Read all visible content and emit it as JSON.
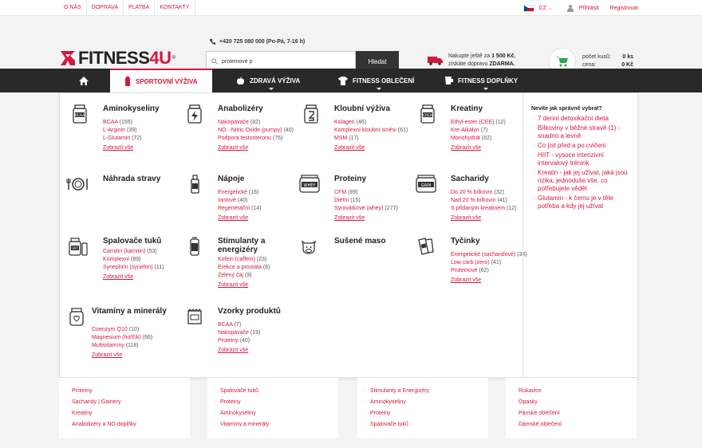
{
  "top": {
    "links": [
      "O NÁS",
      "DOPRAVA",
      "PLATBA",
      "KONTAKTY"
    ],
    "lang": "CZ",
    "login": "Přihlásit",
    "register": "Registrovat"
  },
  "header": {
    "logo_text_a": "FITNESS",
    "logo_text_b": "4U",
    "logo_reg": "®",
    "phone": "+420 725 080 000 (Po-Pá, 7-16 h)",
    "search_value": "proteinové p",
    "search_button": "Hledat",
    "ship_line1_pre": "Nakupte ještě za ",
    "ship_amount": "1 500 Kč",
    "ship_line1_post": ",",
    "ship_line2_pre": "získáte dopravu ",
    "ship_free": "ZDARMA.",
    "cart_count_label": "počet kusů:",
    "cart_count_value": "0 ks",
    "cart_price_label": "cena:",
    "cart_price_value": "0 Kč"
  },
  "nav": {
    "items": [
      "SPORTOVNÍ VÝŽIVA",
      "ZDRAVÁ VÝŽIVA",
      "FITNESS OBLEČENÍ",
      "FITNESS DOPLŇKY"
    ]
  },
  "mega": {
    "show_all": "Zobrazit vše",
    "categories": [
      {
        "title": "Aminokyseliny",
        "items": [
          {
            "n": "BCAA",
            "c": "(155)"
          },
          {
            "n": "L-Arginin",
            "c": "(39)"
          },
          {
            "n": "L-Glutamin",
            "c": "(72)"
          }
        ]
      },
      {
        "title": "Anabolizéry",
        "items": [
          {
            "n": "Nakopávače",
            "c": "(82)"
          },
          {
            "n": "NO - Nitric Oxide (pumpy)",
            "c": "(40)"
          },
          {
            "n": "Podpora testosteronu",
            "c": "(76)"
          }
        ]
      },
      {
        "title": "Kloubní výživa",
        "items": [
          {
            "n": "Kolagen",
            "c": "(46)"
          },
          {
            "n": "Komplexní kloubní směsi",
            "c": "(61)"
          },
          {
            "n": "MSM",
            "c": "(17)"
          }
        ]
      },
      {
        "title": "Kreatiny",
        "items": [
          {
            "n": "Ethyl-ester (CEE)",
            "c": "(12)"
          },
          {
            "n": "Kre-Alkalyn",
            "c": "(7)"
          },
          {
            "n": "Monohydrát",
            "c": "(62)"
          }
        ]
      },
      {
        "title": "Náhrada stravy",
        "items": []
      },
      {
        "title": "Nápoje",
        "items": [
          {
            "n": "Energetické",
            "c": "(16)"
          },
          {
            "n": "Iontové",
            "c": "(40)"
          },
          {
            "n": "Regenerační",
            "c": "(14)"
          }
        ]
      },
      {
        "title": "Proteiny",
        "items": [
          {
            "n": "CFM",
            "c": "(89)"
          },
          {
            "n": "Dietní",
            "c": "(15)"
          },
          {
            "n": "Syrovátkové (whey)",
            "c": "(277)"
          }
        ]
      },
      {
        "title": "Sacharidy",
        "items": [
          {
            "n": "Do 20 % bílkovin",
            "c": "(32)"
          },
          {
            "n": "Nad 20 % bílkovin",
            "c": "(41)"
          },
          {
            "n": "S přidaným kreatinem",
            "c": "(12)"
          }
        ]
      },
      {
        "title": "Spalovače tuků",
        "items": [
          {
            "n": "Carnitin (karnitin)",
            "c": "(53)"
          },
          {
            "n": "Komplexní",
            "c": "(89)"
          },
          {
            "n": "Synephrin (synefrin)",
            "c": "(11)"
          }
        ]
      },
      {
        "title": "Stimulanty a energizéry",
        "items": [
          {
            "n": "Kofein (caffein)",
            "c": "(23)"
          },
          {
            "n": "Erekce a prostata",
            "c": "(8)"
          },
          {
            "n": "Zelený čaj",
            "c": "(9)"
          }
        ]
      },
      {
        "title": "Sušené maso",
        "items": []
      },
      {
        "title": "Tyčinky",
        "items": [
          {
            "n": "Energetické (sacharidové)",
            "c": "(34)"
          },
          {
            "n": "Low carb (zero)",
            "c": "(41)"
          },
          {
            "n": "Proteinové",
            "c": "(62)"
          }
        ]
      },
      {
        "title": "Vitamíny a minerály",
        "items": [
          {
            "n": "Coenzym Q10",
            "c": "(10)"
          },
          {
            "n": "Magnesium (hořčík)",
            "c": "(66)"
          },
          {
            "n": "Multivitamíny",
            "c": "(118)"
          }
        ]
      },
      {
        "title": "Vzorky produktů",
        "items": [
          {
            "n": "BCAA",
            "c": "(7)"
          },
          {
            "n": "Nakopávače",
            "c": "(19)"
          },
          {
            "n": "Proteiny",
            "c": "(40)"
          }
        ]
      }
    ],
    "sidebar_title": "Nevíte jak správně vybrat?",
    "tips": [
      "7 denní detoxikační dieta",
      "Bílkoviny v běžné stravě (1) - snadno a levně",
      "Co jíst před a po cvičení",
      "HIIT - vysoce intenzivní intervalový trénink",
      "Kreatin - jak jej užívat, jaká jsou rizika, jednoduše vše, co potřebujete vědět",
      "Glutamin - k čemu je v těle potřeba a kdy jej užívat"
    ]
  },
  "bottom": {
    "cols": [
      [
        "Proteiny",
        "Sacharidy | Gainery",
        "Kreatiny",
        "Anabolizéry a NO doplňky"
      ],
      [
        "Spalovače tuků",
        "Proteiny",
        "Aminokyseliny",
        "Vitamíny a minerály"
      ],
      [
        "Stimulanty a Energizéry",
        "Aminokyseliny",
        "Proteiny",
        "Spalovače tuků"
      ],
      [
        "Rukavice",
        "Opasky",
        "Pánské oblečení",
        "Dámské oblečení"
      ]
    ]
  },
  "colors": {
    "accent": "#d6173e",
    "nav_bg": "#292929",
    "cart_green": "#2ea84a"
  }
}
